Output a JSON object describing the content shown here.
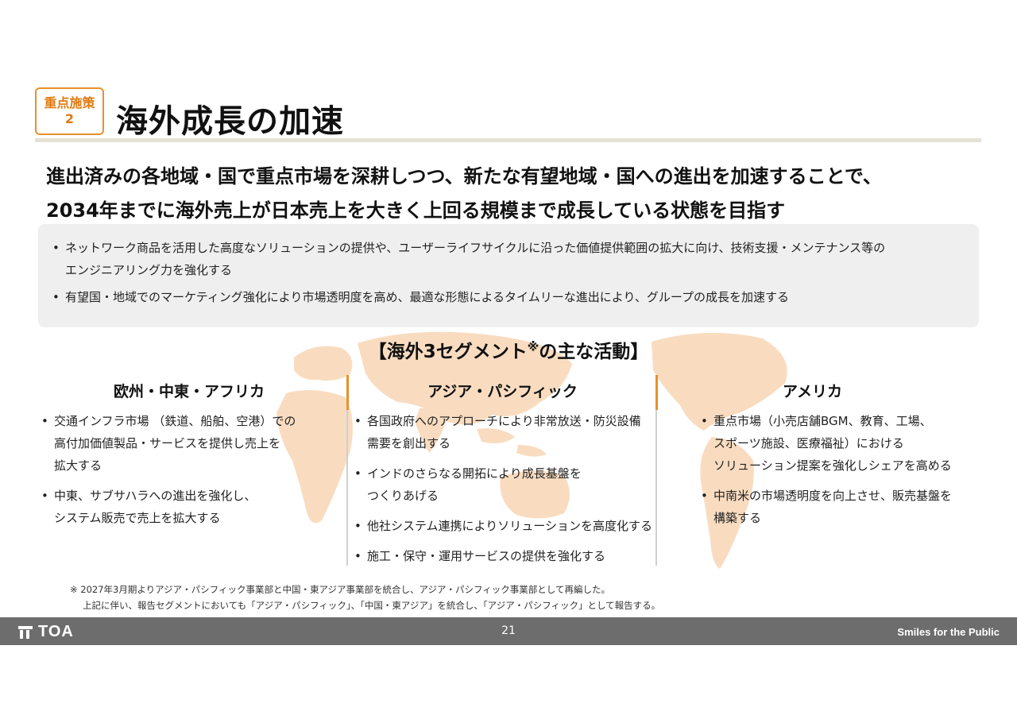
{
  "badge": {
    "line1": "重点施策",
    "line2": "2"
  },
  "title": "海外成長の加速",
  "lead": {
    "line1": "進出済みの各地域・国で重点市場を深耕しつつ、新たな有望地域・国への進出を加速することで、",
    "line2": "2034年までに海外売上が日本売上を大きく上回る規模まで成長している状態を目指す"
  },
  "summary": [
    {
      "line1": "ネットワーク商品を活用した高度なソリューションの提供や、ユーザーライフサイクルに沿った価値提供範囲の拡大に向け、技術支援・メンテナンス等の",
      "line2": "エンジニアリング力を強化する"
    },
    {
      "line1": "有望国・地域でのマーケティング強化により市場透明度を高め、最適な形態によるタイムリーな進出により、グループの成長を加速する",
      "line2": ""
    }
  ],
  "section_title": "【海外3セグメント",
  "section_mark": "※",
  "section_tail": "の主な活動】",
  "bullet": "•",
  "columns": [
    {
      "heading": "欧州・中東・アフリカ",
      "items": [
        {
          "lines": [
            "交通インフラ市場 （鉄道、船舶、空港）での",
            "高付加価値製品・サービスを提供し売上を",
            "拡大する"
          ]
        },
        {
          "lines": [
            "中東、サブサハラへの進出を強化し、",
            "システム販売で売上を拡大する"
          ]
        }
      ]
    },
    {
      "heading": "アジア・パシフィック",
      "items": [
        {
          "lines": [
            "各国政府へのアプローチにより非常放送・防災設備",
            "需要を創出する"
          ]
        },
        {
          "lines": [
            "インドのさらなる開拓により成長基盤を",
            "つくりあげる"
          ]
        },
        {
          "lines": [
            "他社システム連携によりソリューションを高度化する"
          ]
        },
        {
          "lines": [
            "施工・保守・運用サービスの提供を強化する"
          ]
        }
      ]
    },
    {
      "heading": "アメリカ",
      "items": [
        {
          "lines": [
            "重点市場（小売店舗BGM、教育、工場、",
            "スポーツ施設、医療福祉）における",
            "ソリューション提案を強化しシェアを高める"
          ]
        },
        {
          "lines": [
            "中南米の市場透明度を向上させ、販売基盤を",
            "構築する"
          ]
        }
      ]
    }
  ],
  "notes": {
    "line1": "※ 2027年3月期よりアジア・パシフィック事業部と中国・東アジア事業部を統合し、アジア・パシフィック事業部として再編した。",
    "line2": "上記に伴い、報告セグメントにおいても「アジア・パシフィック」、「中国・東アジア」を統合し、「アジア・パシフィック」として報告する。"
  },
  "footer": {
    "logo_text": "TOA",
    "logo_icon": "toa-logo-icon",
    "page_number": "21",
    "slogan": "Smiles for the Public"
  },
  "colors": {
    "accent": "#e8912a",
    "map": "#f9dcc0",
    "footer_bg": "#6d6d6d",
    "summary_bg": "#efefef"
  }
}
